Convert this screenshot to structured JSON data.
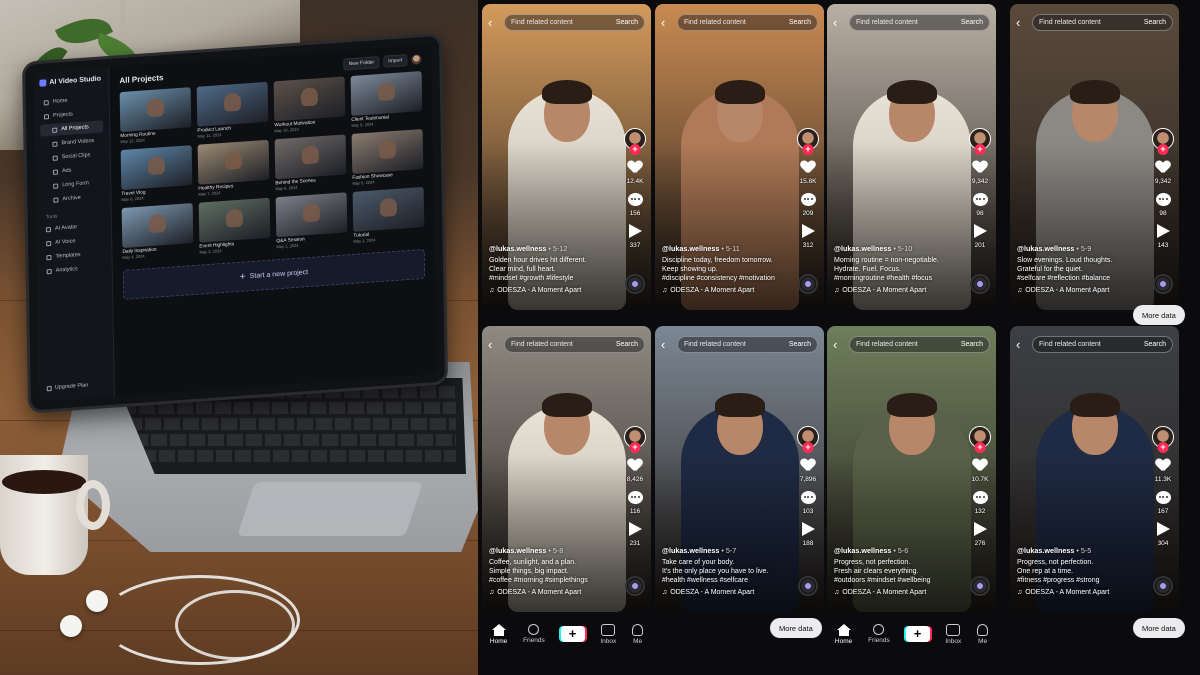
{
  "laptop_app": {
    "title": "AI Video Studio",
    "sidebar": {
      "items": [
        {
          "label": "Home",
          "active": false,
          "sub": false
        },
        {
          "label": "Projects",
          "active": false,
          "sub": false
        },
        {
          "label": "All Projects",
          "active": true,
          "sub": true
        },
        {
          "label": "Brand Videos",
          "active": false,
          "sub": true
        },
        {
          "label": "Social Clips",
          "active": false,
          "sub": true
        },
        {
          "label": "Ads",
          "active": false,
          "sub": true
        },
        {
          "label": "Long Form",
          "active": false,
          "sub": true
        },
        {
          "label": "Archive",
          "active": false,
          "sub": true
        }
      ],
      "tools_label": "Tools",
      "tools": [
        {
          "label": "AI Avatar"
        },
        {
          "label": "AI Voice"
        },
        {
          "label": "Templates"
        },
        {
          "label": "Analytics"
        }
      ],
      "upgrade": "Upgrade Plan"
    },
    "main": {
      "heading": "All Projects",
      "new_folder": "New Folder",
      "import": "Import",
      "projects": [
        {
          "title": "Morning Routine",
          "date": "May 12, 2024",
          "color": "#6b8faa"
        },
        {
          "title": "Product Launch",
          "date": "May 11, 2024",
          "color": "#4f6a86"
        },
        {
          "title": "Workout Motivation",
          "date": "May 10, 2024",
          "color": "#5c5149"
        },
        {
          "title": "Client Testimonial",
          "date": "May 9, 2024",
          "color": "#7d8a9a"
        },
        {
          "title": "Travel Vlog",
          "date": "May 8, 2024",
          "color": "#5d86a8"
        },
        {
          "title": "Healthy Recipes",
          "date": "May 7, 2024",
          "color": "#9a8a72"
        },
        {
          "title": "Behind the Scenes",
          "date": "May 6, 2024",
          "color": "#6f6a68"
        },
        {
          "title": "Fashion Showcase",
          "date": "May 5, 2024",
          "color": "#8a7b70"
        },
        {
          "title": "Daily Inspiration",
          "date": "May 4, 2024",
          "color": "#7d98b0"
        },
        {
          "title": "Event Highlights",
          "date": "May 3, 2024",
          "color": "#5e6e62"
        },
        {
          "title": "Q&A Session",
          "date": "May 2, 2024",
          "color": "#7b7e86"
        },
        {
          "title": "Tutorial",
          "date": "May 1, 2024",
          "color": "#4c5a6a"
        }
      ],
      "new_project": "Start a new project"
    }
  },
  "search": {
    "placeholder": "Find related content",
    "button": "Search"
  },
  "music": "ODESZA - A Moment Apart",
  "more_data": "More data",
  "nav": {
    "home": "Home",
    "friends": "Friends",
    "inbox": "Inbox",
    "me": "Me"
  },
  "posts": [
    {
      "handle": "@lukas.wellness",
      "date": "5-12",
      "caption": "Golden hour drives hit different.\nClear mind, full heart.",
      "tags": "#mindset #growth #lifestyle",
      "likes": "12.4K",
      "comments": "156",
      "shares": "337",
      "bg": "#d49a5c"
    },
    {
      "handle": "@lukas.wellness",
      "date": "5-11",
      "caption": "Discipline today, freedom tomorrow.\nKeep showing up.",
      "tags": "#discipline #consistency #motivation",
      "likes": "15.8K",
      "comments": "209",
      "shares": "312",
      "bg": "#c98a52"
    },
    {
      "handle": "@lukas.wellness",
      "date": "5-10",
      "caption": "Morning routine = non-negotiable.\nHydrate. Fuel. Focus.",
      "tags": "#morningroutine #health #focus",
      "likes": "9,342",
      "comments": "98",
      "shares": "201",
      "bg": "#b8b0a4"
    },
    {
      "handle": "@lukas.wellness",
      "date": "5-9",
      "caption": "Slow evenings. Loud thoughts.\nGrateful for the quiet.",
      "tags": "#selfcare #reflection #balance",
      "likes": "9,342",
      "comments": "98",
      "shares": "143",
      "bg": "#5a4a3c"
    },
    {
      "handle": "@lukas.wellness",
      "date": "5-8",
      "caption": "Coffee, sunlight, and a plan.\nSimple things, big impact.",
      "tags": "#coffee #morning #simplethings",
      "likes": "8,426",
      "comments": "116",
      "shares": "231",
      "bg": "#8f8a82"
    },
    {
      "handle": "@lukas.wellness",
      "date": "5-7",
      "caption": "Take care of your body.\nIt's the only place you have to live.",
      "tags": "#health #wellness #selfcare",
      "likes": "7,896",
      "comments": "103",
      "shares": "188",
      "bg": "#7b8794"
    },
    {
      "handle": "@lukas.wellness",
      "date": "5-6",
      "caption": "Progress, not perfection.\nFresh air clears everything.",
      "tags": "#outdoors #mindset #wellbeing",
      "likes": "10.7K",
      "comments": "132",
      "shares": "276",
      "bg": "#6e7f5c"
    },
    {
      "handle": "@lukas.wellness",
      "date": "5-5",
      "caption": "Progress, not perfection.\nOne rep at a time.",
      "tags": "#fitness #progress #strong",
      "likes": "11.3K",
      "comments": "167",
      "shares": "304",
      "bg": "#3c3f44"
    }
  ]
}
